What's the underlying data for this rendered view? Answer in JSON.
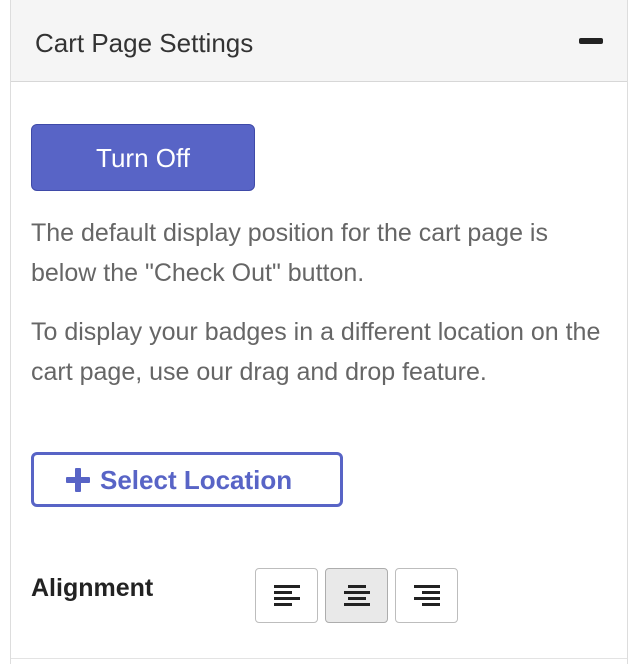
{
  "panel": {
    "title": "Cart Page Settings",
    "collapse_icon": "minus-icon"
  },
  "toggle": {
    "label": "Turn Off",
    "color": "#5864c6"
  },
  "description": {
    "paragraph_1": "The default display position for the cart page is below the \"Check Out\" button.",
    "paragraph_2": "To display your badges in a different location on the cart page, use our drag and drop feature."
  },
  "select_location": {
    "icon": "plus-icon",
    "label": "Select Location"
  },
  "alignment": {
    "label": "Alignment",
    "options": [
      {
        "name": "left",
        "icon": "align-left-icon"
      },
      {
        "name": "center",
        "icon": "align-center-icon"
      },
      {
        "name": "right",
        "icon": "align-right-icon"
      }
    ],
    "selected": "center"
  }
}
